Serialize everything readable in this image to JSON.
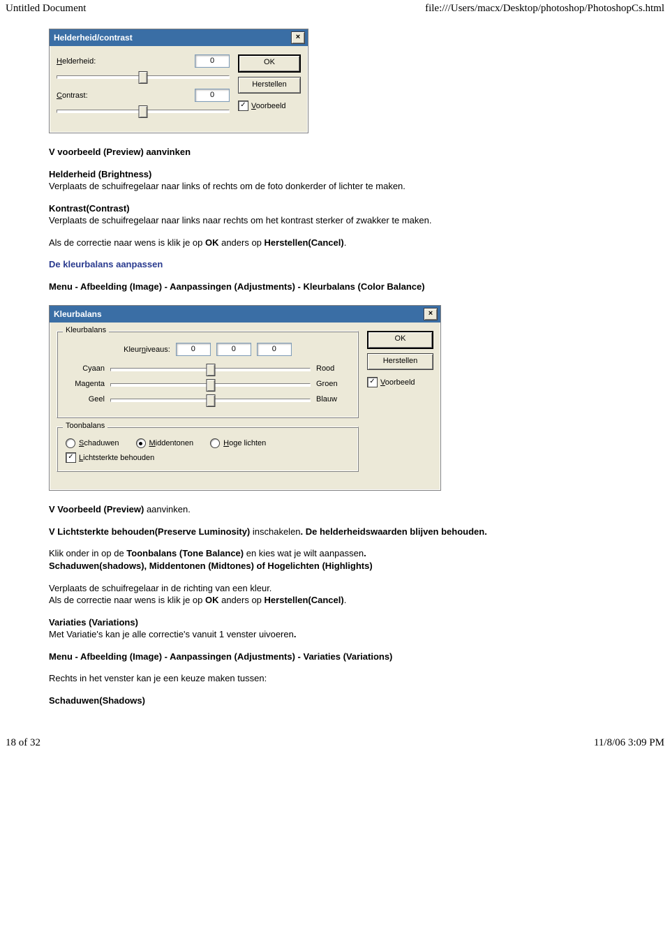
{
  "header": {
    "left": "Untitled Document",
    "right": "file:///Users/macx/Desktop/photoshop/PhotoshopCs.html"
  },
  "dlg_bc": {
    "title": "Helderheid/contrast",
    "brightness_label": "Helderheid:",
    "brightness_value": "0",
    "contrast_label": "Contrast:",
    "contrast_value": "0",
    "ok": "OK",
    "restore": "Herstellen",
    "preview": "Voorbeeld"
  },
  "text": {
    "p1": "V voorbeeld (Preview) aanvinken",
    "p2_title": "Helderheid (Brightness)",
    "p2": "Verplaats de schuifregelaar naar links of rechts om de foto donkerder of lichter te maken.",
    "p3_title": "Kontrast(Contrast)",
    "p3": "Verplaats de schuifregelaar naar links naar rechts om het kontrast sterker of zwakker te maken.",
    "p4a": "Als de correctie naar wens is klik je op ",
    "p4b": "OK",
    "p4c": " anders op ",
    "p4d": "Herstellen(Cancel)",
    "p4e": ".",
    "h_kleurbalans": "De kleurbalans aanpassen",
    "p5": "Menu - Afbeelding (Image) - Aanpassingen (Adjustments) - Kleurbalans (Color Balance)"
  },
  "dlg_cb": {
    "title": "Kleurbalans",
    "group1": "Kleurbalans",
    "levels_label": "Kleurniveaus:",
    "lv1": "0",
    "lv2": "0",
    "lv3": "0",
    "cyan": "Cyaan",
    "red": "Rood",
    "magenta": "Magenta",
    "green": "Groen",
    "yellow": "Geel",
    "blue": "Blauw",
    "group2": "Toonbalans",
    "shadows": "Schaduwen",
    "midtones": "Middentonen",
    "highlights": "Hoge lichten",
    "preserve": "Lichtsterkte behouden",
    "ok": "OK",
    "restore": "Herstellen",
    "preview": "Voorbeeld"
  },
  "text2": {
    "p6a": "V ",
    "p6b": "Voorbeeld (Preview) ",
    "p6c": "aanvinken.",
    "p7a": "V ",
    "p7b": "Lichtsterkte behouden(Preserve Luminosity) ",
    "p7c": "inschakelen",
    "p7d": ". De helderheidswaarden blijven behouden.",
    "p8a": "Klik onder in op de ",
    "p8b": "Toonbalans (Tone Balance) ",
    "p8c": "en kies wat je wilt aanpassen",
    "p8d": ".",
    "p8e": "Schaduwen(shadows), Middentonen (Midtones) of Hogelichten (Highlights)",
    "p9": "Verplaats de schuifregelaar in de richting van een kleur.",
    "p10a": "Als de correctie naar wens is klik je op ",
    "p10b": "OK",
    "p10c": " anders op ",
    "p10d": "Herstellen(Cancel)",
    "p10e": ".",
    "p11_title": "Variaties (Variations)",
    "p11": "Met Variatie's kan je alle correctie's vanuit 1 venster uivoeren",
    "p11b": ".",
    "p12": "Menu - Afbeelding (Image) - Aanpassingen (Adjustments) - Variaties (Variations)",
    "p13": "Rechts in het venster kan je een keuze maken tussen:",
    "p14": "Schaduwen(Shadows)"
  },
  "footer": {
    "left": "18 of 32",
    "right": "11/8/06 3:09 PM"
  }
}
